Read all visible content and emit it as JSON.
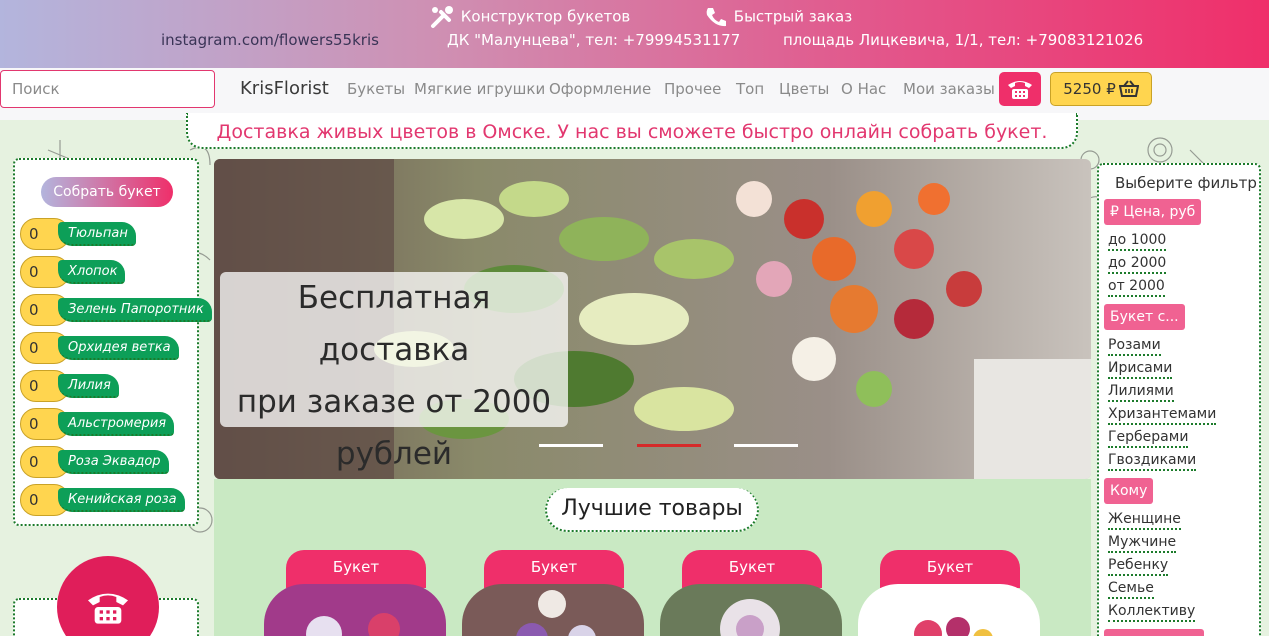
{
  "topbar": {
    "constructor_label": "Конструктор букетов",
    "quick_order_label": "Быстрый заказ",
    "instagram": "instagram.com/flowers55kris",
    "address1": "ДК \"Малунцева\", тел: +79994531177",
    "address2": "площадь Лицкевича, 1/1, тел: +79083121026"
  },
  "nav": {
    "search_placeholder": "Поиск",
    "brand": "KrisFlorist",
    "menu": [
      "Букеты",
      "Мягкие игрушки",
      "Оформление",
      "Прочее",
      "Топ",
      "Цветы",
      "О Нас",
      "Мои заказы"
    ],
    "cart_amount": "5250 ₽"
  },
  "tagline": "Доставка живых цветов в Омске. У нас вы сможете быстро онлайн собрать букет.",
  "left": {
    "build_button": "Собрать букет",
    "flowers": [
      {
        "count": "0",
        "name": "Тюльпан"
      },
      {
        "count": "0",
        "name": "Хлопок"
      },
      {
        "count": "0",
        "name": "Зелень Папоротник"
      },
      {
        "count": "0",
        "name": "Орхидея ветка"
      },
      {
        "count": "0",
        "name": "Лилия"
      },
      {
        "count": "0",
        "name": "Альстромерия"
      },
      {
        "count": "0",
        "name": "Роза Эквадор"
      },
      {
        "count": "0",
        "name": "Кенийская роза"
      }
    ]
  },
  "slider": {
    "caption_lines": [
      "Бесплатная доставка",
      "при заказе от 2000",
      "рублей"
    ],
    "indicators": 3,
    "active_indicator": 2
  },
  "best": {
    "title": "Лучшие товары",
    "cards": [
      "Букет",
      "Букет",
      "Букет",
      "Букет"
    ]
  },
  "right": {
    "title": "Выберите фильтр",
    "price_chip": "₽ Цена, руб",
    "price_options": [
      "до 1000",
      "до 2000",
      "от 2000"
    ],
    "bouquet_chip": "Букет с...",
    "bouquet_options": [
      "Розами",
      "Ирисами",
      "Лилиями",
      "Хризантемами",
      "Герберами",
      "Гвоздиками"
    ],
    "whom_chip": "Кому",
    "whom_options": [
      "Женщине",
      "Мужчине",
      "Ребенку",
      "Семье",
      "Коллективу"
    ]
  },
  "colors": {
    "accent": "#ef2f6a",
    "green": "#0d9f58",
    "yellow": "#ffd54f",
    "background": "#e6f2e0"
  },
  "icons": [
    "tools-icon",
    "phone-icon",
    "telephone-icon",
    "basket-icon"
  ]
}
